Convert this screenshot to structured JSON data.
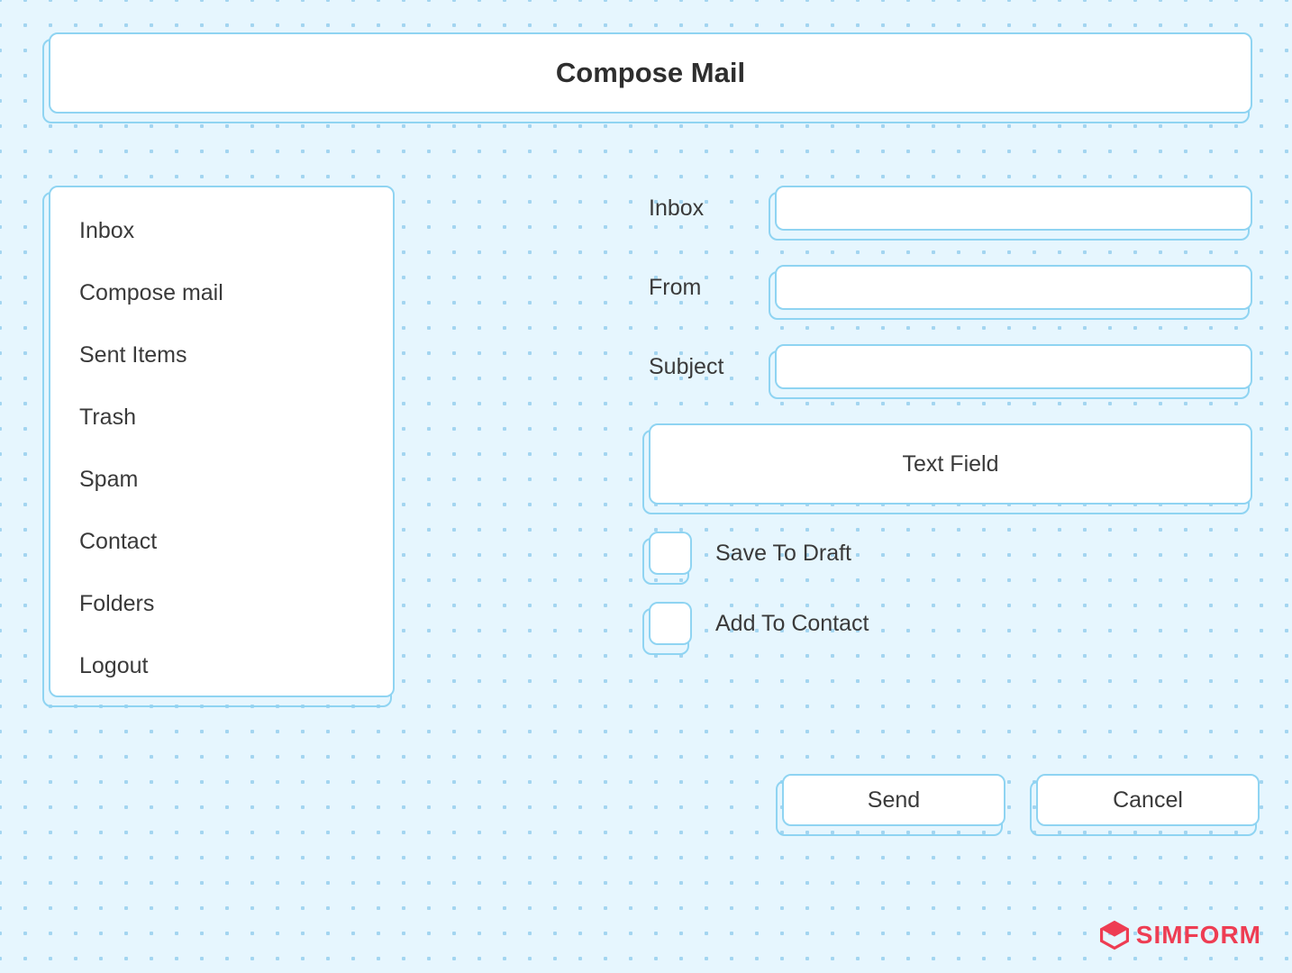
{
  "header": {
    "title": "Compose Mail"
  },
  "sidebar": {
    "items": [
      {
        "label": "Inbox"
      },
      {
        "label": "Compose mail"
      },
      {
        "label": "Sent Items"
      },
      {
        "label": "Trash"
      },
      {
        "label": "Spam"
      },
      {
        "label": "Contact"
      },
      {
        "label": "Folders"
      },
      {
        "label": "Logout"
      }
    ]
  },
  "form": {
    "fields": [
      {
        "label": "Inbox",
        "value": ""
      },
      {
        "label": "From",
        "value": ""
      },
      {
        "label": "Subject",
        "value": ""
      }
    ],
    "textfield_label": "Text Field",
    "checkboxes": [
      {
        "label": "Save To Draft"
      },
      {
        "label": "Add To Contact"
      }
    ],
    "buttons": {
      "send": "Send",
      "cancel": "Cancel"
    }
  },
  "brand": {
    "name": "SIMFORM"
  }
}
